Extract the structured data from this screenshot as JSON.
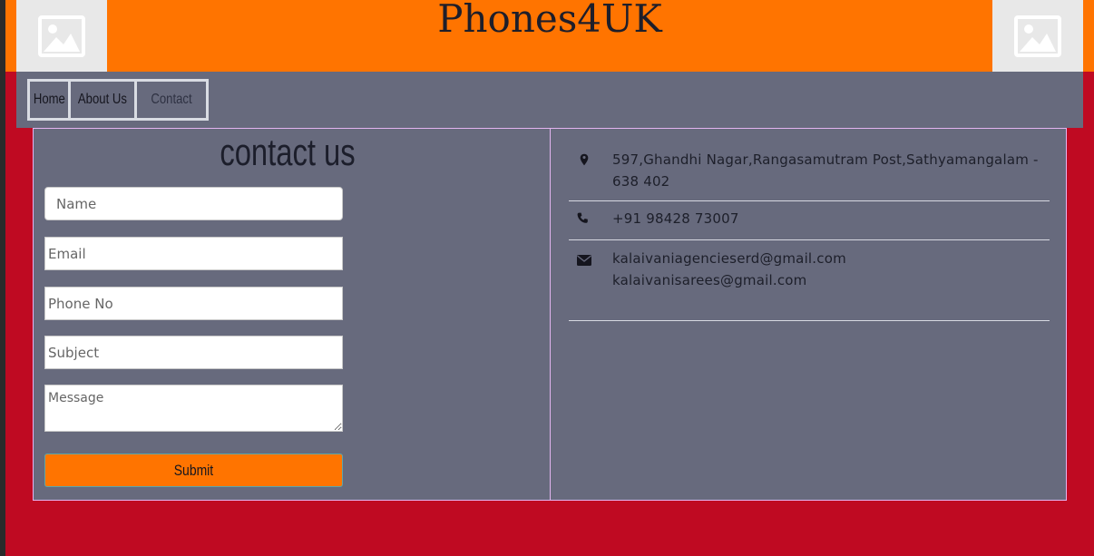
{
  "header": {
    "title": "Phones4UK",
    "left_logo_icon": "image-placeholder-icon",
    "right_logo_icon": "image-placeholder-icon",
    "colors": {
      "header_bg": "#ff7400",
      "page_bg": "#bf0a22",
      "panel_bg": "#676a7d"
    }
  },
  "nav": {
    "items": [
      {
        "label": "Home"
      },
      {
        "label": "About Us"
      },
      {
        "label": "Contact us"
      }
    ]
  },
  "contact_form": {
    "heading": "contact us",
    "name_placeholder": "Name",
    "email_placeholder": "Email",
    "phone_placeholder": "Phone No",
    "subject_placeholder": "Subject",
    "message_placeholder": "Message",
    "submit_label": "Submit"
  },
  "contact_info": {
    "address": "597,Ghandhi Nagar,Rangasamutram Post,Sathyamangalam - 638 402",
    "address_icon": "map-marker-icon",
    "phone": "+91 98428 73007",
    "phone_icon": "phone-icon",
    "email_1": "kalaivaniagencieserd@gmail.com",
    "email_2": "kalaivanisarees@gmail.com",
    "email_icon": "envelope-icon"
  }
}
